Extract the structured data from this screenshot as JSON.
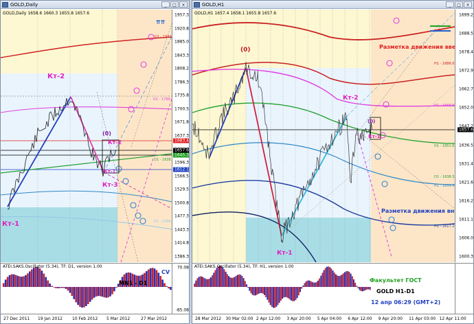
{
  "left_window": {
    "title": "GOLD,Daily",
    "symbol_line": "GOLD,Daily  1658.6 1660.3 1655.8 1657.6",
    "price_ticks": [
      "1957.3",
      "1920.8",
      "1885.0",
      "1843.3",
      "1808.2",
      "1786.3",
      "1735.8",
      "1700.5",
      "1671.8",
      "1637.3",
      "1606.6",
      "1596.3",
      "1566.5",
      "1529.5",
      "1500.8",
      "1477.3",
      "1443.3",
      "1414.8",
      "1386.3"
    ],
    "price_tags": [
      {
        "text": "1683.4",
        "color": "#e02020"
      },
      {
        "text": "1657.6",
        "color": "#000000"
      },
      {
        "text": "1645.3",
        "color": "#20a020"
      },
      {
        "text": "1612.1",
        "color": "#2040c0"
      }
    ],
    "date_ticks": [
      "27 Dec 2011",
      "19 Jan 2012",
      "10 Feb 2012",
      "5 Mar 2012",
      "27 Mar 2012"
    ],
    "annotations": {
      "kt2": "Кт-2",
      "kt1": "Кт-1",
      "kt3": "Кт-3",
      "zero": "(0)",
      "kt2b": "Кт-2",
      "kt1b": "Кт-1"
    },
    "level_labels": {
      "d1_upper": "D1 - 1932",
      "d1_mid": "D1 - 1799",
      "d1_low": "D1 - 1638.",
      "d1_bottom": "D1 - 1556"
    },
    "oscillator": {
      "title": "ATEI.SAKS.Oscillator (5.34), TF: D1, version 1.00",
      "top": "70.08",
      "bottom": "-85.08",
      "label": "MN1 - D1",
      "cv": "CV"
    }
  },
  "right_window": {
    "title": "GOLD,H1",
    "symbol_line": "GOLD,H1  1657.4 1658.1 1655.8 1657.6",
    "price_ticks": [
      "1699.2",
      "1688.5",
      "1678.4",
      "1672.9",
      "1662.7",
      "1652.0",
      "1647.2",
      "1636.5",
      "1631.4",
      "1621.6",
      "1616.2",
      "1611.1",
      "1606.0",
      "1600.3"
    ],
    "price_tags": [
      {
        "text": "1657.6",
        "color": "#000000"
      }
    ],
    "date_ticks": [
      "28 Mar 2012",
      "30 Mar 02:00",
      "2 Apr 12:00",
      "3 Apr 20:00",
      "5 Apr 04:00",
      "6 Apr 12:00",
      "9 Apr 20:00",
      "11 Apr 03:00",
      "12 Apr 11:00"
    ],
    "annotations": {
      "zero": "(0)",
      "kt2": "Кт-2",
      "kt1": "Кт-1",
      "zero_b": "(0)",
      "kt1_b": "Кт-1",
      "up_movement": "Разметка движения вверх",
      "down_movement": "Разметка движения вниз"
    },
    "level_labels": {
      "h1_1686": "H1 - 1686.0",
      "h1_1668": "H1 - 1668.8",
      "h1_1651": "H1 - 1651.6",
      "h1_1634": "H1 - 1634.4",
      "h1_1617": "H1 - 1617.2",
      "d1_1638": "D1 - 1638.5"
    },
    "oscillator": {
      "title": "ATEI.SAKS.Oscillator (5.34), TF: H1, version 1.00",
      "faculty": "Факультет ГОСТ",
      "pair": "GOLD   H1-D1",
      "datetime": "12 апр 06:29  (GMT+2)"
    }
  }
}
